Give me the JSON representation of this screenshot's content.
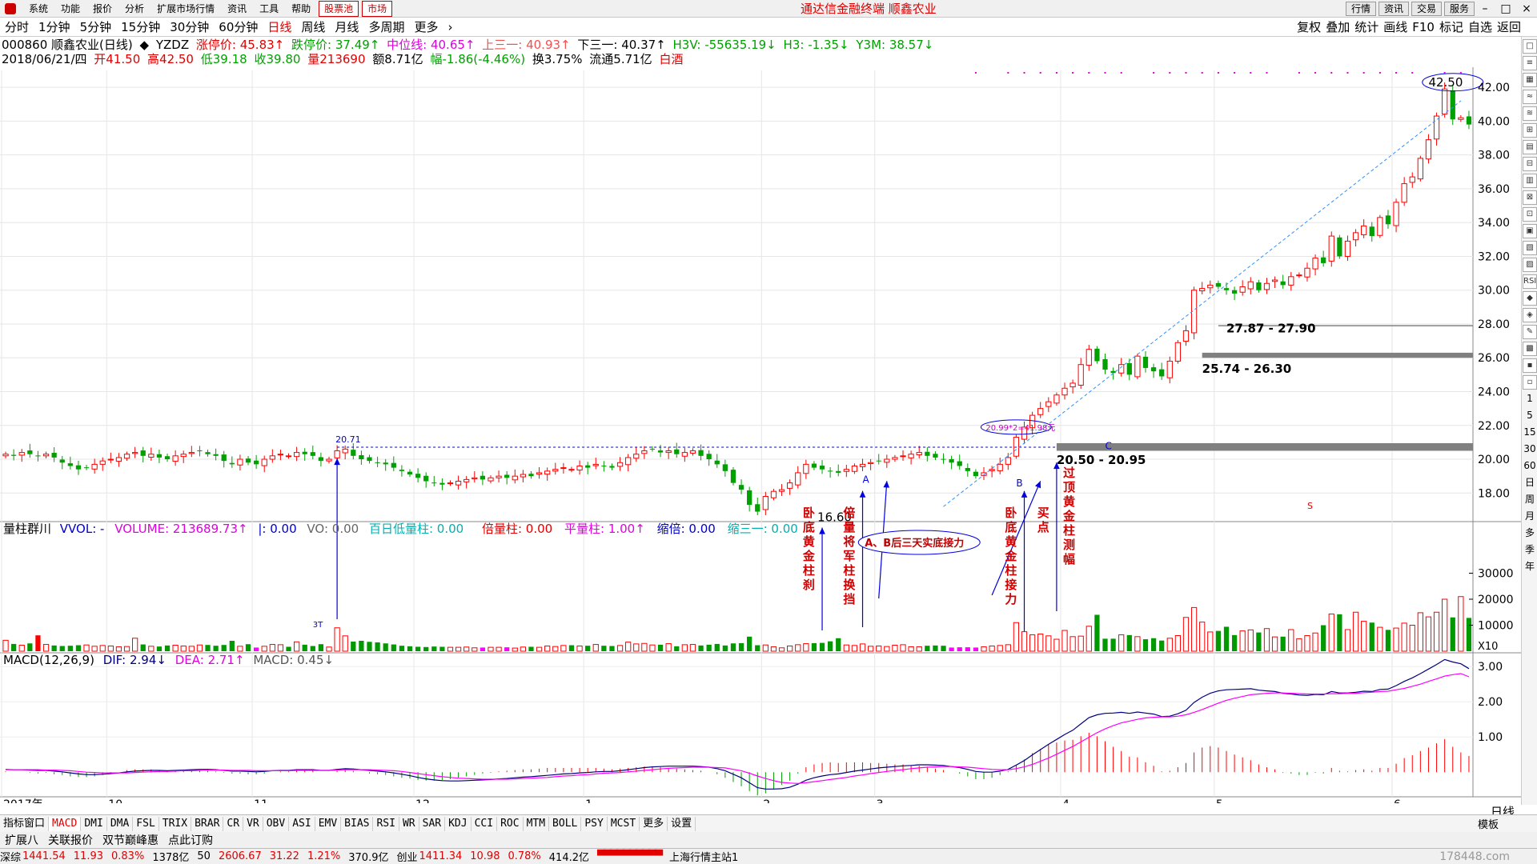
{
  "menubar": {
    "items": [
      "系统",
      "功能",
      "报价",
      "分析",
      "扩展市场行情",
      "资讯",
      "工具",
      "帮助"
    ],
    "highlight_items": [
      "股票池",
      "市场"
    ],
    "app_title": "通达信金融终端    顺鑫农业",
    "right_buttons": [
      "行情",
      "资讯",
      "交易",
      "服务"
    ]
  },
  "tabs": [
    "分时",
    "1分钟",
    "5分钟",
    "15分钟",
    "30分钟",
    "60分钟",
    "日线",
    "周线",
    "月线",
    "多周期",
    "更多"
  ],
  "active_tab": "日线",
  "toolbar_right": [
    "复权",
    "叠加",
    "统计",
    "画线",
    "F10",
    "标记",
    "自选",
    "返回"
  ],
  "header": {
    "code_name": "000860 顺鑫农业(日线)",
    "indicator": "YZDZ",
    "zt_label": "涨停价: 45.83↑",
    "dt_label": "跌停价: 37.49↑",
    "zw_label": "中位线: 40.65↑",
    "s31_label": "上三一: 40.93↑",
    "x31_label": "下三一: 40.37↑",
    "h3v_label": "H3V: -55635.19↓",
    "h3_label": "H3: -1.35↓",
    "y3m_label": "Y3M: 38.57↓"
  },
  "quote": {
    "date": "2018/06/21/四",
    "open": "开41.50",
    "high": "高42.50",
    "low": "低39.18",
    "close": "收39.80",
    "vol": "量213690",
    "amount": "额8.71亿",
    "change": "幅-1.86(-4.46%)",
    "turnover": "换3.75%",
    "float": "流通5.71亿",
    "sector": "白酒"
  },
  "volume_header": {
    "name": "量柱群川",
    "vvol": "VVOL: -",
    "volume": "VOLUME: 213689.73↑",
    "i": "|: 0.00",
    "vo": "VO: 0.00",
    "bdl": "百日低量柱: 0.00",
    "blz": "倍量柱: 0.00",
    "plz": "平量柱: 1.00↑",
    "sb": "缩倍: 0.00",
    "s31": "缩三一: 0.00"
  },
  "macd_header": {
    "name": "MACD(12,26,9)",
    "dif": "DIF: 2.94↓",
    "dea": "DEA: 2.71↑",
    "macd": "MACD: 0.45↓"
  },
  "chart_data": {
    "type": "candlestick",
    "price_axis": {
      "min": 16.5,
      "max": 43,
      "ticks": [
        18,
        20,
        22,
        24,
        26,
        28,
        30,
        32,
        34,
        36,
        38,
        40,
        42
      ],
      "tick_labels": [
        "18.00",
        "20.00",
        "22.00",
        "24.00",
        "26.00",
        "28.00",
        "30.00",
        "32.00",
        "34.00",
        "36.00",
        "38.00",
        "40.00",
        "42.00"
      ]
    },
    "volume_axis": {
      "max": 40000,
      "ticks": [
        10000,
        20000,
        30000
      ],
      "unit": "X10"
    },
    "macd_axis": {
      "min": -0.7,
      "max": 3.3,
      "ticks": [
        1,
        2,
        3
      ],
      "tick_labels": [
        "1.00",
        "2.00",
        "3.00"
      ]
    },
    "x_labels": [
      "2017年",
      "10",
      "11",
      "12",
      "1",
      "2",
      "3",
      "4",
      "5",
      "6"
    ],
    "x_label_bars": [
      0,
      13,
      31,
      51,
      72,
      94,
      108,
      131,
      150,
      172
    ],
    "closes": [
      20.3,
      20.2,
      20.4,
      20.3,
      20.2,
      20.3,
      20.1,
      19.8,
      19.6,
      19.4,
      19.5,
      19.7,
      19.9,
      20.0,
      20.1,
      20.3,
      20.4,
      20.2,
      20.3,
      20.1,
      20.0,
      20.2,
      20.3,
      20.4,
      20.5,
      20.3,
      20.2,
      19.9,
      19.7,
      20.0,
      19.8,
      19.7,
      20.0,
      20.2,
      20.3,
      20.2,
      20.4,
      20.3,
      20.2,
      19.9,
      20.0,
      20.5,
      20.6,
      20.2,
      20.0,
      19.9,
      19.8,
      19.7,
      19.5,
      19.3,
      19.1,
      18.9,
      18.7,
      18.6,
      18.5,
      18.6,
      18.7,
      18.8,
      18.9,
      18.8,
      18.9,
      19.0,
      18.9,
      19.0,
      19.1,
      19.0,
      19.2,
      19.3,
      19.4,
      19.5,
      19.4,
      19.6,
      19.5,
      19.7,
      19.6,
      19.5,
      19.8,
      20.1,
      20.3,
      20.5,
      20.6,
      20.4,
      20.5,
      20.3,
      20.4,
      20.5,
      20.2,
      20.0,
      19.7,
      19.3,
      18.6,
      18.2,
      17.3,
      16.9,
      17.8,
      18.1,
      18.2,
      18.6,
      19.2,
      19.7,
      19.5,
      19.4,
      19.3,
      19.2,
      19.4,
      19.6,
      19.7,
      19.8,
      19.9,
      20.0,
      20.1,
      20.2,
      20.3,
      20.4,
      20.2,
      20.1,
      20.0,
      19.8,
      19.6,
      19.3,
      19.0,
      19.2,
      19.4,
      19.7,
      20.1,
      21.3,
      21.9,
      22.6,
      23.0,
      23.4,
      23.8,
      24.2,
      24.5,
      25.6,
      26.5,
      25.8,
      25.3,
      25.1,
      25.6,
      25.0,
      26.1,
      25.4,
      25.2,
      24.9,
      25.8,
      26.9,
      27.6,
      30.0,
      30.1,
      30.3,
      30.2,
      30.0,
      29.8,
      30.2,
      30.5,
      30.0,
      30.4,
      30.6,
      30.3,
      30.8,
      30.9,
      31.3,
      31.9,
      31.6,
      33.2,
      32.0,
      32.9,
      33.4,
      33.8,
      33.2,
      34.3,
      33.9,
      35.2,
      36.3,
      36.7,
      37.8,
      38.9,
      40.3,
      41.9,
      40.1,
      40.2,
      39.8
    ],
    "volumes": [
      4200,
      2800,
      2300,
      3000,
      6100,
      2600,
      2200,
      2000,
      2100,
      2300,
      2400,
      1900,
      2200,
      2000,
      1700,
      1800,
      5000,
      2600,
      1900,
      1800,
      2200,
      2300,
      2000,
      1900,
      2400,
      2400,
      2100,
      2400,
      4000,
      1900,
      2700,
      1400,
      1900,
      2600,
      2500,
      1700,
      3600,
      2500,
      2000,
      2700,
      1600,
      9000,
      5900,
      3700,
      4000,
      3600,
      3400,
      3000,
      2600,
      2100,
      1900,
      1700,
      1600,
      1800,
      1700,
      1500,
      1500,
      1600,
      1300,
      1400,
      1500,
      1500,
      1500,
      1200,
      1600,
      1700,
      1500,
      2000,
      1800,
      2200,
      2300,
      2000,
      2100,
      2600,
      2100,
      2000,
      2200,
      3500,
      2800,
      3000,
      2400,
      2500,
      2900,
      1900,
      2500,
      2600,
      2200,
      2500,
      2800,
      2200,
      3000,
      3100,
      5600,
      2300,
      2400,
      1700,
      1300,
      2000,
      2500,
      2900,
      3100,
      3200,
      3800,
      5000,
      2400,
      2200,
      2800,
      1900,
      2000,
      1800,
      2300,
      2500,
      1700,
      1700,
      2100,
      2200,
      2100,
      1400,
      1500,
      1500,
      1400,
      1700,
      2000,
      2200,
      2500,
      11000,
      7500,
      6300,
      6600,
      5900,
      4600,
      8000,
      5600,
      5800,
      9600,
      14000,
      4800,
      4800,
      6300,
      6200,
      5600,
      4600,
      5000,
      4100,
      5000,
      6000,
      13000,
      16800,
      11200,
      7400,
      7800,
      9400,
      6200,
      7800,
      8200,
      7200,
      8700,
      5500,
      5600,
      8300,
      4800,
      6000,
      7000,
      10000,
      14300,
      14200,
      8300,
      15000,
      11500,
      11000,
      9200,
      8200,
      8900,
      10800,
      10000,
      14800,
      13200,
      15000,
      20000,
      13000,
      21000,
      12800,
      21300
    ],
    "macd_dif": [
      0.08,
      0.07,
      0.07,
      0.06,
      0.05,
      0.05,
      0.03,
      0.01,
      -0.02,
      -0.05,
      -0.07,
      -0.07,
      -0.06,
      -0.04,
      -0.02,
      0.01,
      0.03,
      0.04,
      0.05,
      0.05,
      0.04,
      0.05,
      0.06,
      0.07,
      0.08,
      0.08,
      0.07,
      0.05,
      0.03,
      0.03,
      0.02,
      0.01,
      0.02,
      0.04,
      0.05,
      0.05,
      0.07,
      0.07,
      0.07,
      0.05,
      0.05,
      0.08,
      0.1,
      0.09,
      0.07,
      0.05,
      0.03,
      0.01,
      -0.02,
      -0.06,
      -0.1,
      -0.15,
      -0.19,
      -0.22,
      -0.24,
      -0.25,
      -0.25,
      -0.24,
      -0.23,
      -0.22,
      -0.21,
      -0.19,
      -0.18,
      -0.16,
      -0.14,
      -0.13,
      -0.11,
      -0.09,
      -0.07,
      -0.05,
      -0.04,
      -0.02,
      -0.01,
      0.01,
      0.02,
      0.02,
      0.04,
      0.07,
      0.1,
      0.13,
      0.15,
      0.16,
      0.17,
      0.17,
      0.17,
      0.17,
      0.16,
      0.14,
      0.1,
      0.04,
      -0.06,
      -0.16,
      -0.3,
      -0.44,
      -0.48,
      -0.48,
      -0.47,
      -0.43,
      -0.34,
      -0.23,
      -0.16,
      -0.11,
      -0.07,
      -0.05,
      -0.01,
      0.03,
      0.06,
      0.09,
      0.12,
      0.14,
      0.16,
      0.18,
      0.19,
      0.21,
      0.21,
      0.2,
      0.19,
      0.16,
      0.13,
      0.08,
      0.02,
      0.0,
      0.0,
      0.03,
      0.08,
      0.2,
      0.33,
      0.49,
      0.64,
      0.79,
      0.93,
      1.07,
      1.19,
      1.37,
      1.55,
      1.63,
      1.67,
      1.68,
      1.7,
      1.67,
      1.71,
      1.68,
      1.65,
      1.58,
      1.59,
      1.66,
      1.76,
      1.98,
      2.13,
      2.24,
      2.31,
      2.34,
      2.35,
      2.36,
      2.37,
      2.33,
      2.31,
      2.29,
      2.24,
      2.22,
      2.19,
      2.18,
      2.21,
      2.2,
      2.29,
      2.25,
      2.25,
      2.27,
      2.3,
      2.29,
      2.35,
      2.36,
      2.46,
      2.58,
      2.68,
      2.8,
      2.93,
      3.06,
      3.2,
      3.13,
      3.08,
      2.94
    ],
    "macd_dea": [
      0.07,
      0.07,
      0.07,
      0.07,
      0.07,
      0.06,
      0.06,
      0.05,
      0.04,
      0.02,
      0.0,
      -0.01,
      -0.02,
      -0.02,
      -0.02,
      -0.02,
      -0.01,
      0.0,
      0.01,
      0.02,
      0.02,
      0.03,
      0.04,
      0.04,
      0.05,
      0.06,
      0.06,
      0.06,
      0.05,
      0.05,
      0.05,
      0.04,
      0.04,
      0.04,
      0.04,
      0.04,
      0.05,
      0.05,
      0.05,
      0.05,
      0.05,
      0.06,
      0.07,
      0.07,
      0.07,
      0.07,
      0.06,
      0.05,
      0.04,
      0.02,
      -0.01,
      -0.04,
      -0.07,
      -0.1,
      -0.13,
      -0.15,
      -0.17,
      -0.18,
      -0.19,
      -0.2,
      -0.2,
      -0.2,
      -0.2,
      -0.19,
      -0.18,
      -0.17,
      -0.16,
      -0.15,
      -0.13,
      -0.11,
      -0.1,
      -0.08,
      -0.07,
      -0.05,
      -0.03,
      -0.02,
      -0.01,
      0.01,
      0.03,
      0.05,
      0.07,
      0.09,
      0.11,
      0.12,
      0.13,
      0.14,
      0.14,
      0.14,
      0.13,
      0.12,
      0.08,
      0.04,
      -0.03,
      -0.11,
      -0.18,
      -0.24,
      -0.29,
      -0.31,
      -0.32,
      -0.3,
      -0.27,
      -0.24,
      -0.21,
      -0.18,
      -0.15,
      -0.11,
      -0.08,
      -0.04,
      -0.01,
      0.02,
      0.05,
      0.07,
      0.1,
      0.12,
      0.14,
      0.15,
      0.16,
      0.16,
      0.15,
      0.14,
      0.12,
      0.1,
      0.08,
      0.07,
      0.07,
      0.1,
      0.15,
      0.22,
      0.31,
      0.4,
      0.51,
      0.62,
      0.73,
      0.86,
      0.99,
      1.12,
      1.23,
      1.32,
      1.4,
      1.45,
      1.5,
      1.54,
      1.56,
      1.57,
      1.57,
      1.59,
      1.63,
      1.7,
      1.78,
      1.87,
      1.96,
      2.04,
      2.1,
      2.15,
      2.2,
      2.22,
      2.24,
      2.25,
      2.25,
      2.24,
      2.23,
      2.22,
      2.22,
      2.22,
      2.23,
      2.23,
      2.24,
      2.24,
      2.26,
      2.27,
      2.29,
      2.3,
      2.34,
      2.38,
      2.44,
      2.5,
      2.58,
      2.65,
      2.73,
      2.77,
      2.8,
      2.71
    ]
  },
  "annotations": {
    "hline_label": "20.71",
    "ellipse_label": "20.99*2=41.98元",
    "top_label": "42.50",
    "low_label": "16.60",
    "zone_labels": [
      "27.87 - 27.90",
      "25.74 - 26.30",
      "20.50 - 20.95"
    ],
    "letters": [
      "A",
      "B",
      "C"
    ],
    "vol_small": "3T",
    "volume_notes": [
      "卧底黄金柱刹",
      "倍量将军柱换挡",
      "卧底黄金柱接力",
      "买点",
      "过顶黄金柱测幅"
    ],
    "ab_note": "A、B后三天实底接力",
    "marker_s": "S"
  },
  "right_tools": [
    "□",
    "≡",
    "▦",
    "≈",
    "≋",
    "⊞",
    "▤",
    "⊟",
    "▥",
    "⊠",
    "⊡",
    "▣",
    "▧",
    "▨",
    "RSI",
    "◆",
    "◈",
    "✎",
    "▩",
    "▪",
    "▫"
  ],
  "right_tool_texts": [
    "1",
    "5",
    "15",
    "30",
    "60",
    "日",
    "周",
    "月",
    "多",
    "季",
    "年"
  ],
  "period_label": "日线",
  "mode_label": "模板",
  "indicator_tabs": [
    "指标窗口",
    "MACD",
    "DMI",
    "DMA",
    "FSL",
    "TRIX",
    "BRAR",
    "CR",
    "VR",
    "OBV",
    "ASI",
    "EMV",
    "BIAS",
    "RSI",
    "WR",
    "SAR",
    "KDJ",
    "CCI",
    "ROC",
    "MTM",
    "BOLL",
    "PSY",
    "MCST",
    "更多",
    "设置"
  ],
  "active_indicator": "MACD",
  "ext_tabs": [
    "扩展八",
    "关联报价",
    "双节巅峰惠",
    "点此订购"
  ],
  "status": {
    "sz_name": "深综",
    "sz_val": "1441.54",
    "sz_chg": "11.93",
    "sz_pct": "0.83%",
    "sz_amt": "1378亿",
    "sh_num": "50",
    "sh_val": "2606.67",
    "sh_chg": "31.22",
    "sh_pct": "1.21%",
    "sh_amt": "370.9亿",
    "cy_name": "创业",
    "cy_val": "1411.34",
    "cy_chg": "10.98",
    "cy_pct": "0.78%",
    "cy_amt": "414.2亿",
    "server": "上海行情主站1"
  },
  "watermark": "178448.com",
  "colors": {
    "up": "#ff0000",
    "down": "#00a000",
    "dif": "#000080",
    "dea": "#ff00ff",
    "annot": "#0000e0"
  }
}
